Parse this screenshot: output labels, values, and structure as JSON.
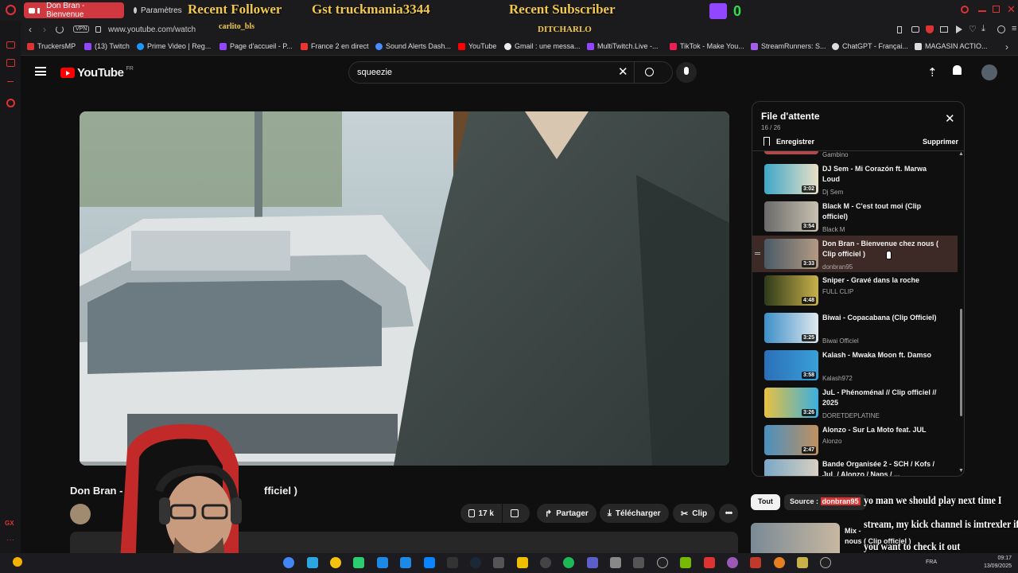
{
  "browser": {
    "active_tab": "Don Bran - Bienvenue",
    "settings_tab": "Paramètres",
    "url": "www.youtube.com/watch",
    "vpn_label": "VPN"
  },
  "stream_overlay": {
    "recent_follower_label": "Recent Follower",
    "recent_follower_name": "carlito_bls",
    "gst_label": "Gst truckmania3344",
    "recent_subscriber_label": "Recent Subscriber",
    "recent_subscriber_name": "DITCHARLO",
    "counter": "0"
  },
  "bookmarks": [
    {
      "label": "TruckersMP",
      "color": "#d33"
    },
    {
      "label": "(13) Twitch",
      "color": "#9147ff"
    },
    {
      "label": "Prime Video | Reg...",
      "color": "#1a98ff"
    },
    {
      "label": "Page d'accueil - P...",
      "color": "#9147ff"
    },
    {
      "label": "France 2 en direct",
      "color": "#e33"
    },
    {
      "label": "Sound Alerts Dash...",
      "color": "#4a8cff"
    },
    {
      "label": "YouTube",
      "color": "#f00"
    },
    {
      "label": "Gmail : une messa...",
      "color": "#eee"
    },
    {
      "label": "MultiTwitch.Live -...",
      "color": "#9147ff"
    },
    {
      "label": "TikTok - Make You...",
      "color": "#ee1d52"
    },
    {
      "label": "StreamRunners: S...",
      "color": "#a55eea"
    },
    {
      "label": "ChatGPT - Françai...",
      "color": "#ddd"
    },
    {
      "label": "MAGASIN ACTIO...",
      "color": "#ddd"
    }
  ],
  "youtube": {
    "logo": "YouTube",
    "country": "FR",
    "search_value": "squeezie"
  },
  "queue": {
    "title": "File d'attente",
    "position": "16 / 26",
    "save_label": "Enregistrer",
    "delete_label": "Supprimer",
    "partial_top_channel": "Gambino",
    "items": [
      {
        "title": "DJ Sem - Mi Corazón ft. Marwa Loud",
        "channel": "Dj Sem",
        "duration": "3:02",
        "c1": "#3fa7c8",
        "c2": "#e9e0c6"
      },
      {
        "title": "Black M - C'est tout moi (Clip officiel)",
        "channel": "Black M",
        "duration": "3:54",
        "c1": "#6b6b6b",
        "c2": "#c8c0b0"
      },
      {
        "title": "Don Bran - Bienvenue chez nous ( Clip officiel )",
        "channel": "donbran95",
        "duration": "3:33",
        "c1": "#4a5a66",
        "c2": "#b39a84",
        "active": true
      },
      {
        "title": "Sniper - Gravé dans la roche",
        "channel": "FULL CLIP",
        "duration": "4:48",
        "c1": "#2e3a1a",
        "c2": "#c9b04a"
      },
      {
        "title": "Biwai - Copacabana (Clip Officiel)",
        "channel": "Biwai Officiel",
        "duration": "3:25",
        "c1": "#3c8fc9",
        "c2": "#e0e8ee"
      },
      {
        "title": "Kalash - Mwaka Moon ft. Damso",
        "channel": "Kalash972",
        "duration": "3:58",
        "c1": "#2a6fb8",
        "c2": "#3a9fd8"
      },
      {
        "title": "JuL - Phénoménal // Clip officiel // 2025",
        "channel": "DORETDEPLATINE",
        "duration": "3:26",
        "c1": "#e8c040",
        "c2": "#3bb0e0"
      },
      {
        "title": "Alonzo - Sur La Moto feat. JUL",
        "channel": "Alonzo",
        "duration": "2:47",
        "c1": "#4a90c0",
        "c2": "#c09060"
      },
      {
        "title": "Bande Organisée 2 - SCH / Kofs / JuL / Alonzo / Naps / ...",
        "channel": "",
        "duration": "",
        "c1": "#7aa8c8",
        "c2": "#d8d0c0"
      }
    ]
  },
  "video": {
    "title_visible": "Don Bran -",
    "title_suffix": "fficiel )",
    "likes": "17 k",
    "share_label": "Partager",
    "download_label": "Télécharger",
    "clip_label": "Clip"
  },
  "chips": {
    "all": "Tout",
    "source_label": "Source :",
    "source_value": "donbran95"
  },
  "recommend": {
    "title_line1": "Mix -",
    "title_line2": "nous ( Clip officiel )"
  },
  "chat_overlay": {
    "line1": "yo man we should play next time I",
    "line2": "stream, my kick channel is imtrexler if",
    "line3": "you want to check it out"
  },
  "taskbar": {
    "lang": "FRA",
    "time": "09:17",
    "date": "13/09/2025"
  }
}
